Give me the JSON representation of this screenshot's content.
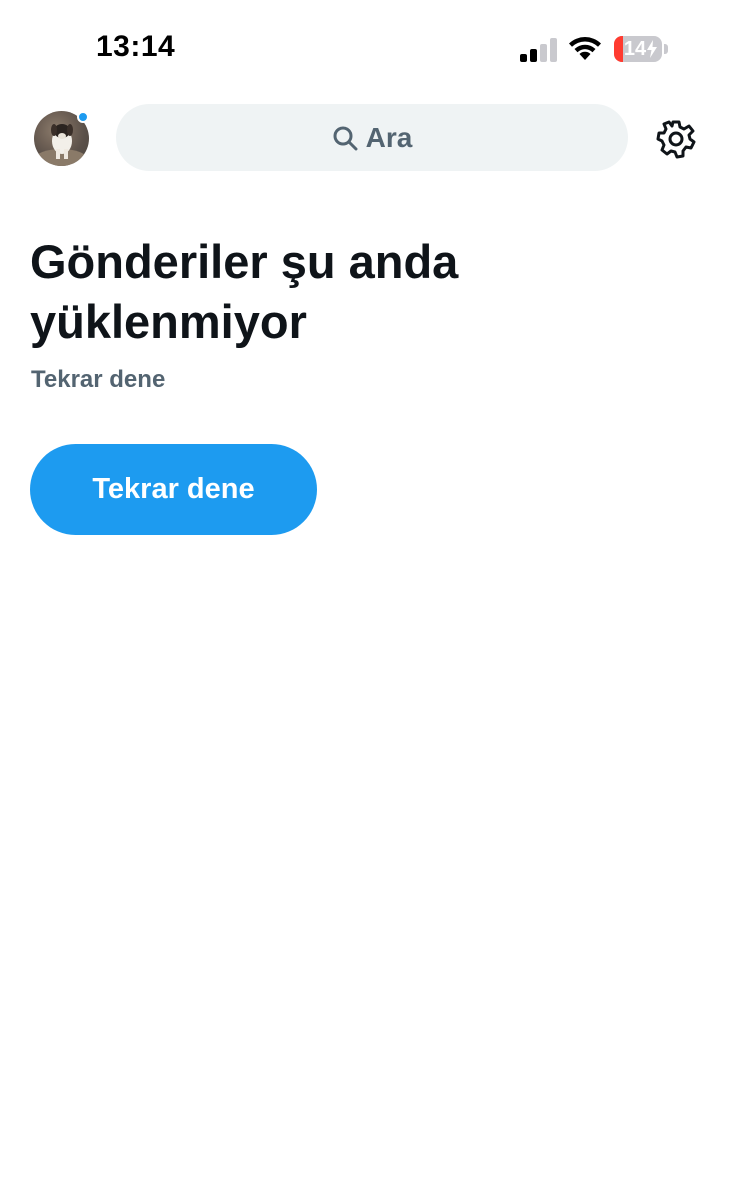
{
  "status_bar": {
    "time": "13:14",
    "battery_level_percent": 14,
    "battery_label": "14",
    "signal_icon": "cellular-signal-icon",
    "wifi_icon": "wifi-icon",
    "battery_icon": "battery-charging-icon"
  },
  "header": {
    "avatar_icon": "profile-avatar",
    "search": {
      "placeholder": "Ara",
      "icon": "search-icon"
    },
    "settings_icon": "gear-icon"
  },
  "main": {
    "title": "Gönderiler şu anda yüklenmiyor",
    "subtitle": "Tekrar dene",
    "retry_button_label": "Tekrar dene"
  },
  "colors": {
    "accent": "#1d9bf0",
    "text_primary": "#0f1419",
    "text_secondary": "#536471",
    "search_bg": "#eff3f4",
    "battery_low": "#ff3b30"
  }
}
